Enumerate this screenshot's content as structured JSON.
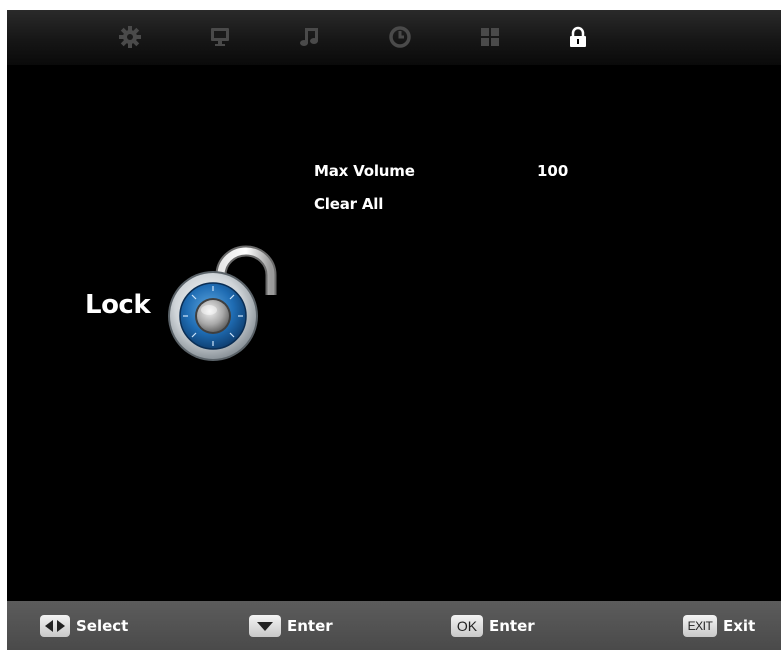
{
  "topbar": {
    "tabs": [
      {
        "icon": "gear-icon"
      },
      {
        "icon": "monitor-icon"
      },
      {
        "icon": "music-note-icon"
      },
      {
        "icon": "clock-icon"
      },
      {
        "icon": "grid-icon"
      },
      {
        "icon": "lock-icon",
        "active": true
      }
    ]
  },
  "page": {
    "title": "Lock",
    "image": "padlock-icon"
  },
  "menu": {
    "items": [
      {
        "label": "Max Volume",
        "value": "100"
      },
      {
        "label": "Clear All",
        "value": ""
      }
    ]
  },
  "hints": {
    "select": {
      "key_icon": "left-right-arrows-icon",
      "label": "Select"
    },
    "enter_down": {
      "key_icon": "down-arrow-icon",
      "label": "Enter"
    },
    "enter_ok": {
      "key": "OK",
      "label": "Enter"
    },
    "exit": {
      "key": "EXIT",
      "label": "Exit"
    }
  },
  "colors": {
    "background": "#000000",
    "text": "#ffffff",
    "inactive_icon": "#4a4a4a",
    "active_icon": "#ffffff",
    "bottom_bar": "#555555"
  }
}
